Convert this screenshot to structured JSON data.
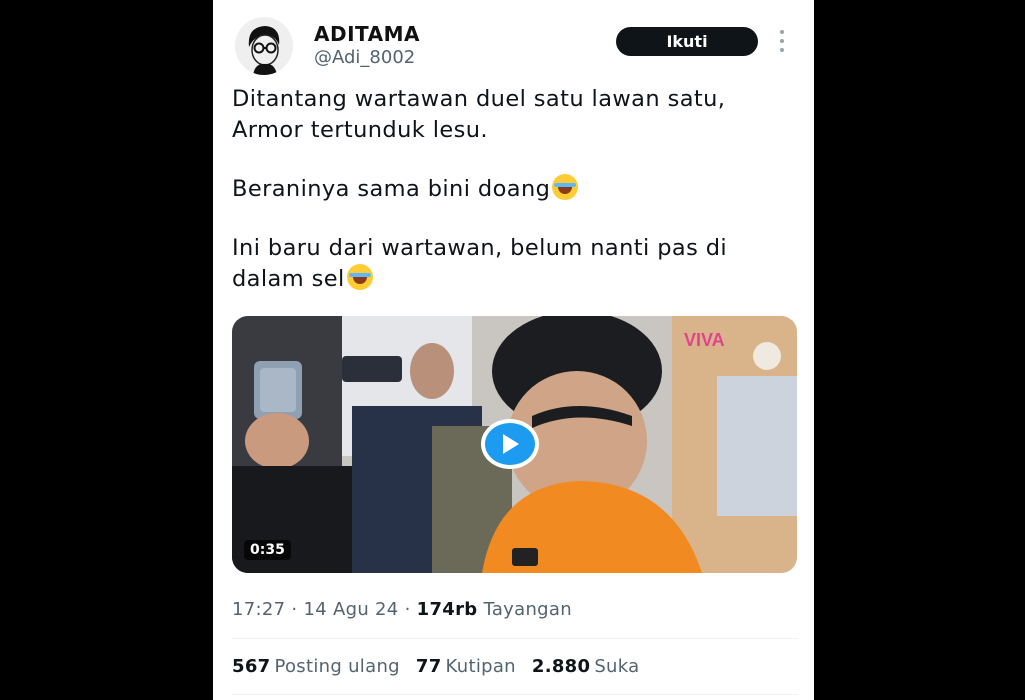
{
  "author": {
    "name": "ADITAMA",
    "handle": "@Adi_8002",
    "follow_label": "Ikuti"
  },
  "tweet": {
    "line1": "Ditantang wartawan duel satu lawan satu, Armor tertunduk lesu.",
    "line2": "Beraninya sama bini doang",
    "line3": "Ini baru dari wartawan, belum nanti pas di dalam sel",
    "emoji1": "rolling-on-floor-laughing",
    "emoji2": "tears-of-joy"
  },
  "media": {
    "duration": "0:35",
    "watermark": "VIVA",
    "progress": 0
  },
  "meta": {
    "time": "17:27",
    "date": "14 Agu 24",
    "views": "174rb",
    "views_label": "Tayangan"
  },
  "stats": {
    "reposts": "567",
    "reposts_label": "Posting ulang",
    "quotes": "77",
    "quotes_label": "Kutipan",
    "likes": "2.880",
    "likes_label": "Suka"
  },
  "colors": {
    "accent": "#1d9bf0",
    "secondary_text": "#536471",
    "primary_text": "#0f1419"
  }
}
